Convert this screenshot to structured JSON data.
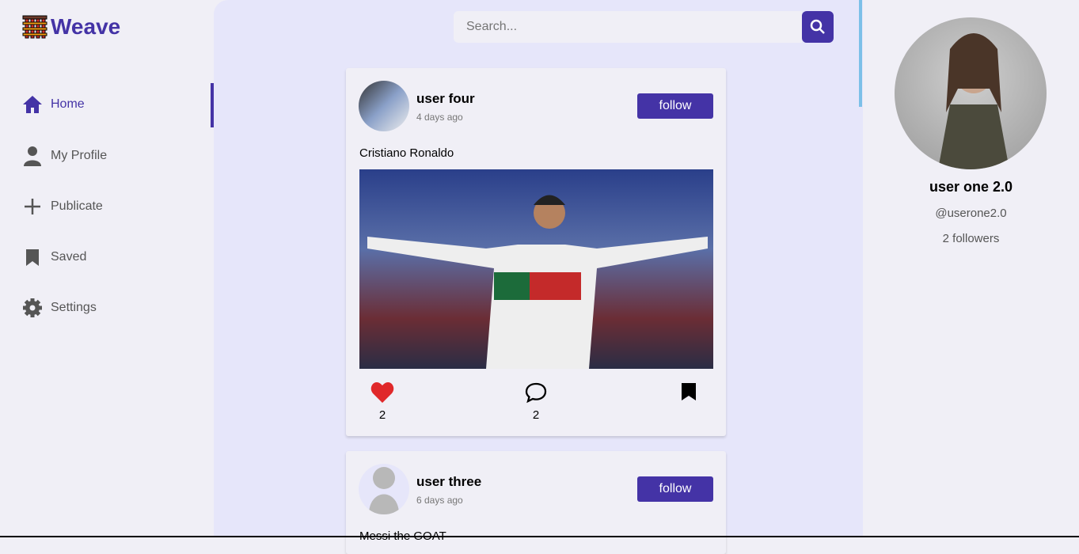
{
  "app": {
    "name": "Weave"
  },
  "nav": [
    {
      "label": "Home",
      "icon": "home-icon"
    },
    {
      "label": "My Profile",
      "icon": "user-icon"
    },
    {
      "label": "Publicate",
      "icon": "plus-icon"
    },
    {
      "label": "Saved",
      "icon": "bookmark-icon"
    },
    {
      "label": "Settings",
      "icon": "gear-icon"
    }
  ],
  "search": {
    "placeholder": "Search..."
  },
  "posts": [
    {
      "user": "user four",
      "time": "4 days ago",
      "follow": "follow",
      "caption": "Cristiano Ronaldo",
      "likes": "2",
      "comments": "2"
    },
    {
      "user": "user three",
      "time": "6 days ago",
      "follow": "follow",
      "caption": "Messi the GOAT"
    }
  ],
  "profile": {
    "name": "user one 2.0",
    "handle": "@userone2.0",
    "followers": "2 followers"
  },
  "colors": {
    "accent": "#4433a6",
    "like": "#e0282a"
  }
}
